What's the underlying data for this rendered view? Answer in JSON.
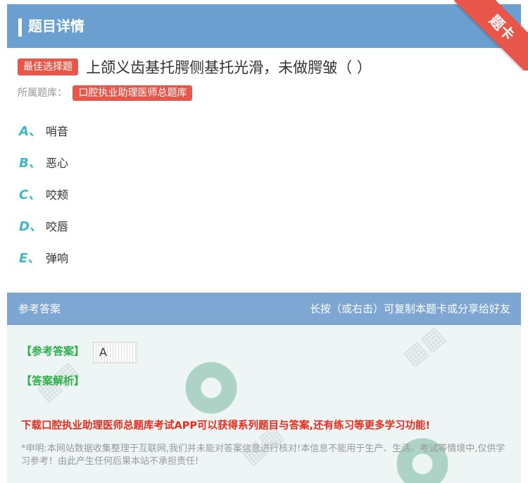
{
  "header": {
    "title": "题目详情",
    "ribbon": "题卡"
  },
  "question": {
    "type_tag": "最佳选择题",
    "text": "上颌义齿基托腭侧基托光滑，未做腭皱（ ）",
    "source_label": "所属题库：",
    "source_name": "口腔执业助理医师总题库"
  },
  "options": [
    {
      "letter": "A、",
      "text": "哨音"
    },
    {
      "letter": "B、",
      "text": "恶心"
    },
    {
      "letter": "C、",
      "text": "咬颊"
    },
    {
      "letter": "D、",
      "text": "咬唇"
    },
    {
      "letter": "E、",
      "text": "弹响"
    }
  ],
  "answer_section": {
    "title": "参考答案",
    "hint": "长按（或右击）可复制本题卡或分享给好友",
    "answer_label": "【参考答案】",
    "answer_value": "A",
    "analysis_label": "【答案解析】",
    "download_text": "下载口腔执业助理医师总题库考试APP可以获得系列题目与答案,还有练习等更多学习功能!",
    "disclaimer": "*申明:本网站数据收集整理于互联网,我们并未能对答案信息进行核对!本信息不能用于生产、生活、考试等情境中,仅供学习参考！由此产生任何后果本站不承担责任!"
  },
  "colors": {
    "header_bg": "#6a9fd0",
    "accent_red": "#e8564a",
    "option_letter": "#3fb6c6",
    "answer_green": "#2fae4a"
  }
}
